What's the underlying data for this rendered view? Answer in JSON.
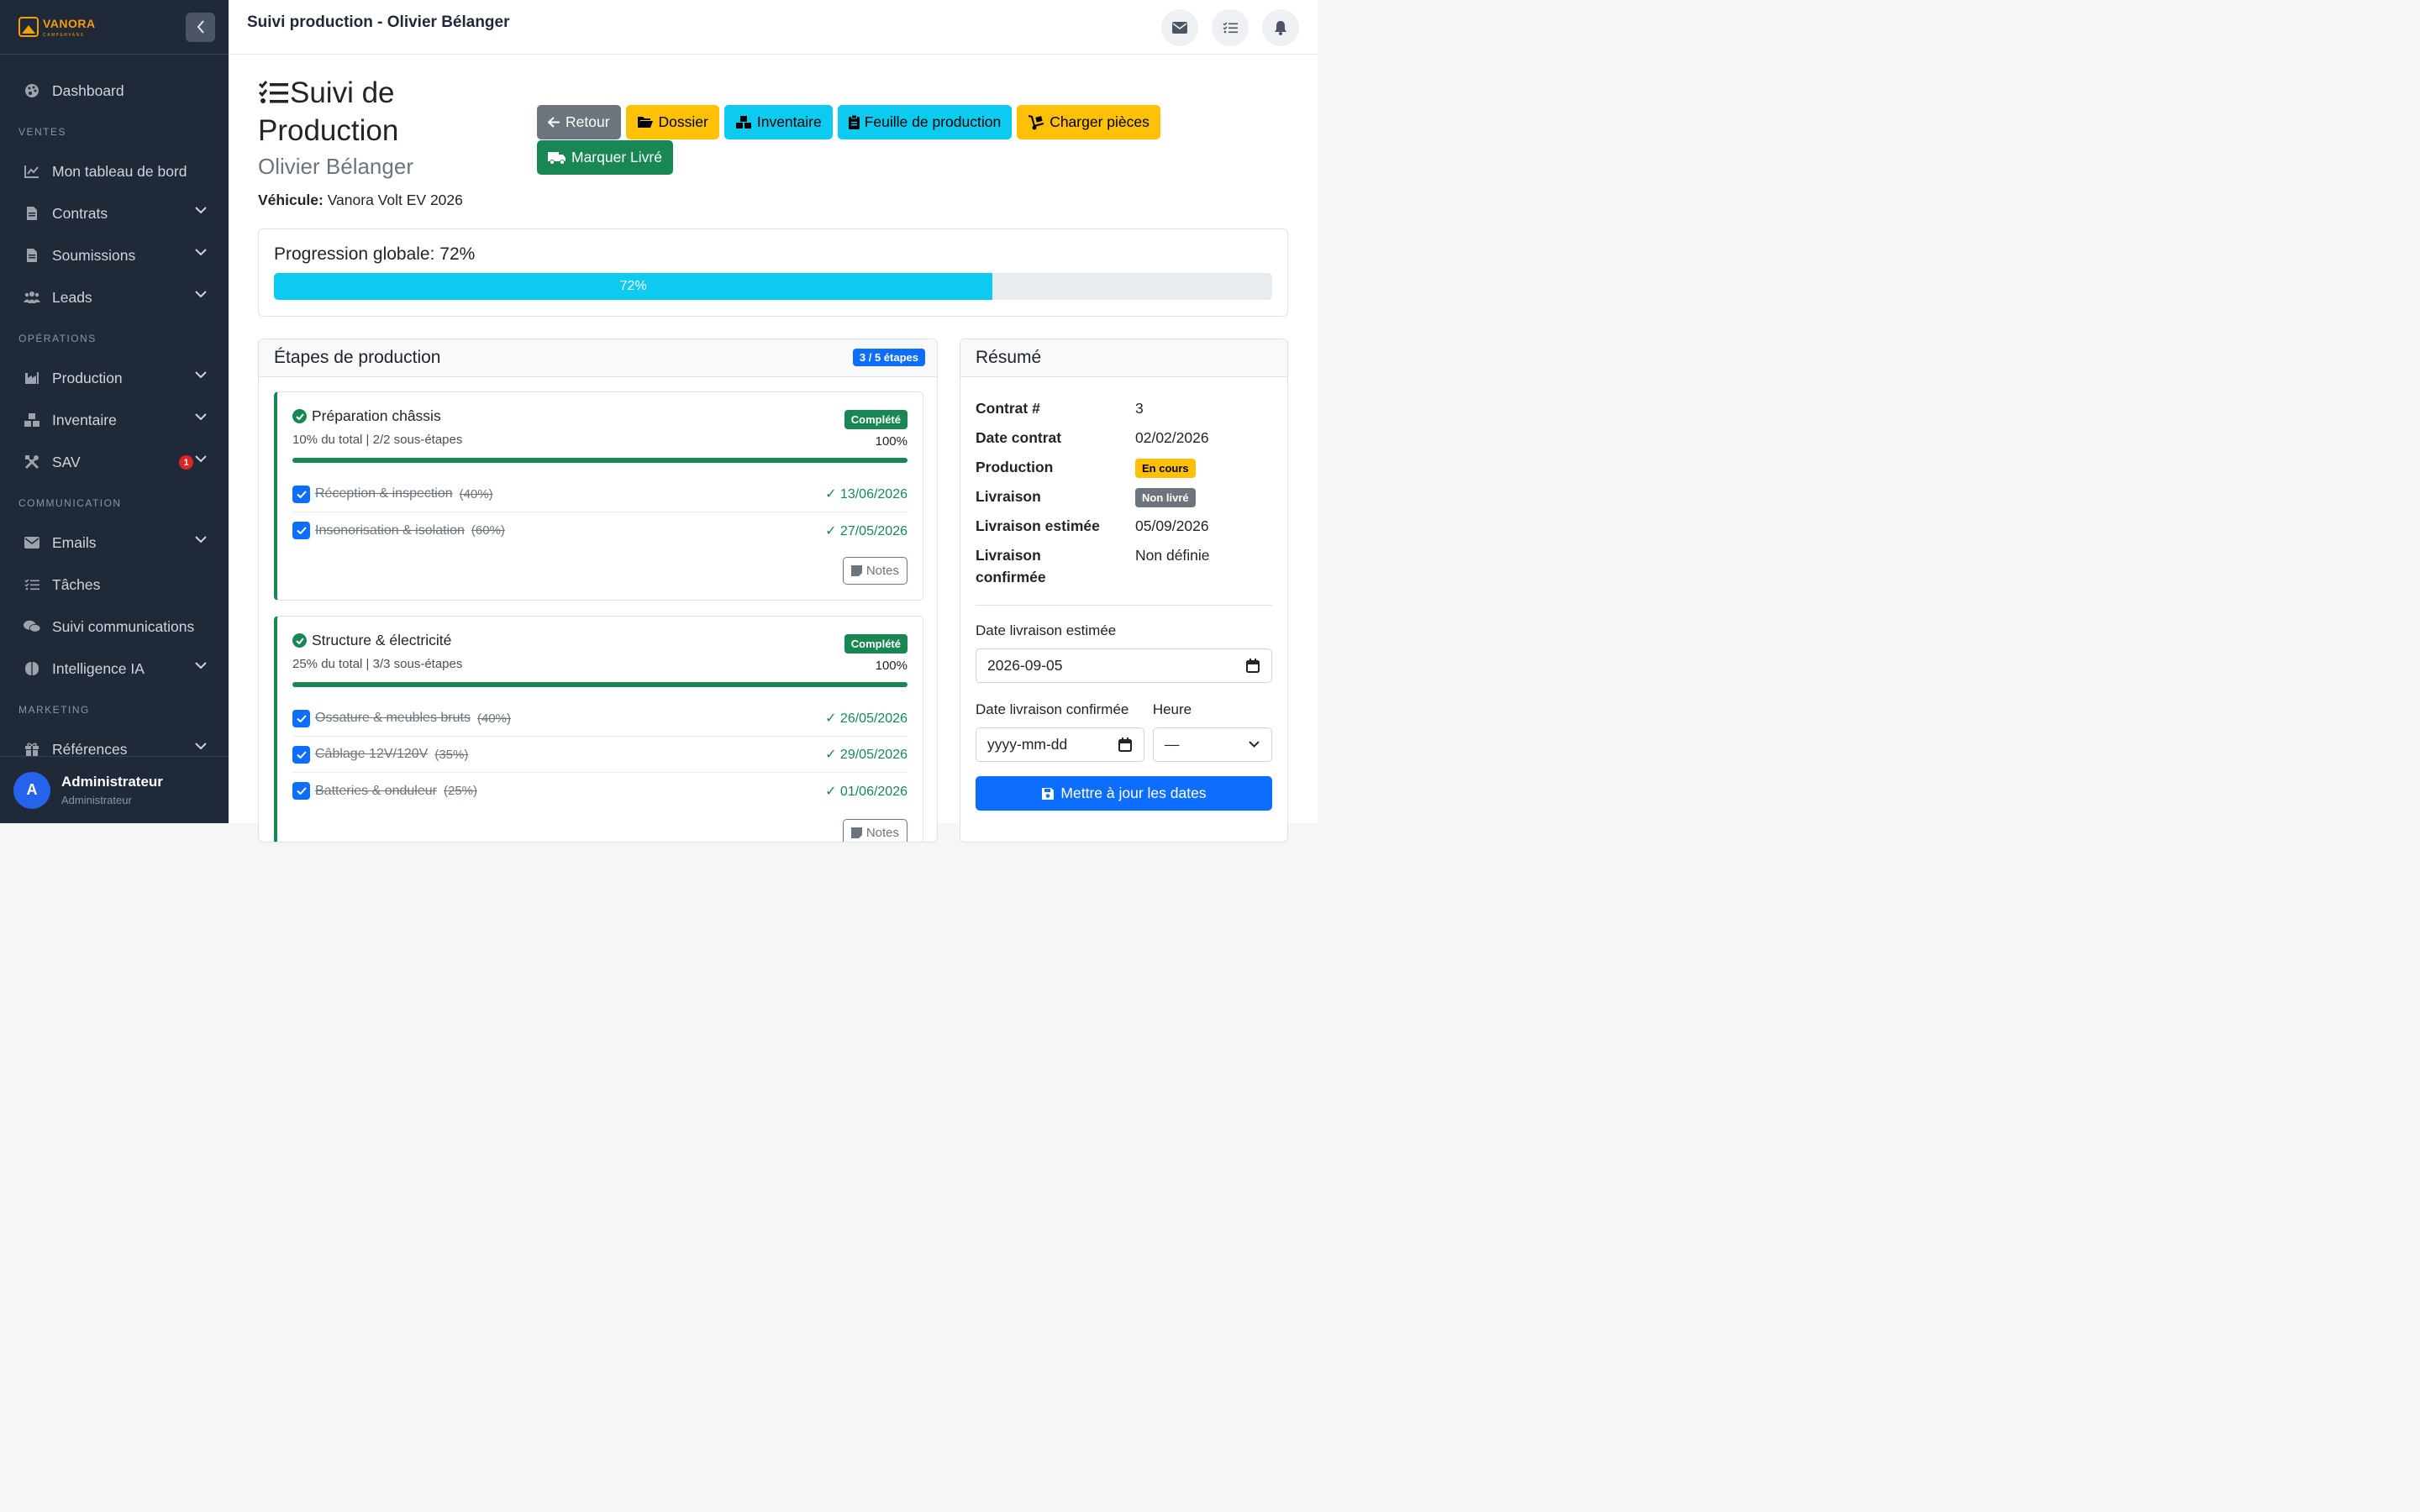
{
  "brand": {
    "name": "VANORA",
    "tagline": "CAMPERVANS"
  },
  "sidebar": {
    "items": [
      {
        "label": "Dashboard",
        "icon": "palette-icon"
      },
      {
        "section": "VENTES"
      },
      {
        "label": "Mon tableau de bord",
        "icon": "chart-line-icon"
      },
      {
        "label": "Contrats",
        "icon": "file-icon",
        "expandable": true
      },
      {
        "label": "Soumissions",
        "icon": "file-icon",
        "expandable": true
      },
      {
        "label": "Leads",
        "icon": "users-icon",
        "expandable": true
      },
      {
        "section": "OPÉRATIONS"
      },
      {
        "label": "Production",
        "icon": "industry-icon",
        "expandable": true
      },
      {
        "label": "Inventaire",
        "icon": "boxes-icon",
        "expandable": true
      },
      {
        "label": "SAV",
        "icon": "tools-icon",
        "expandable": true,
        "badge": "1"
      },
      {
        "section": "COMMUNICATION"
      },
      {
        "label": "Emails",
        "icon": "envelope-icon",
        "expandable": true
      },
      {
        "label": "Tâches",
        "icon": "tasks-icon"
      },
      {
        "label": "Suivi communications",
        "icon": "comments-icon"
      },
      {
        "label": "Intelligence IA",
        "icon": "brain-icon",
        "expandable": true
      },
      {
        "section": "MARKETING"
      },
      {
        "label": "Références",
        "icon": "gift-icon",
        "expandable": true
      }
    ],
    "user": {
      "initial": "A",
      "name": "Administrateur",
      "role": "Administrateur"
    }
  },
  "topbar": {
    "title": "Suivi production - Olivier Bélanger"
  },
  "page": {
    "title": "Suivi de Production",
    "client": "Olivier Bélanger",
    "vehicle_label": "Véhicule:",
    "vehicle_value": "Vanora Volt EV 2026"
  },
  "actions": {
    "back": "Retour",
    "folder": "Dossier",
    "inventory": "Inventaire",
    "sheet": "Feuille de production",
    "load_parts": "Charger pièces",
    "mark_delivered": "Marquer Livré"
  },
  "progress": {
    "label": "Progression globale: 72%",
    "value": 72,
    "bar_text": "72%"
  },
  "steps": {
    "header": "Étapes de production",
    "count": "3 / 5 étapes",
    "notes_label": "Notes",
    "items": [
      {
        "title": "Préparation châssis",
        "meta": "10% du total | 2/2 sous-étapes",
        "status": "Complété",
        "percent": "100%",
        "subs": [
          {
            "name": "Réception & inspection",
            "weight": "(40%)",
            "date": "13/06/2026"
          },
          {
            "name": "Insonorisation & isolation",
            "weight": "(60%)",
            "date": "27/05/2026"
          }
        ]
      },
      {
        "title": "Structure & électricité",
        "meta": "25% du total | 3/3 sous-étapes",
        "status": "Complété",
        "percent": "100%",
        "subs": [
          {
            "name": "Ossature & meubles bruts",
            "weight": "(40%)",
            "date": "26/05/2026"
          },
          {
            "name": "Câblage 12V/120V",
            "weight": "(35%)",
            "date": "29/05/2026"
          },
          {
            "name": "Batteries & onduleur",
            "weight": "(25%)",
            "date": "01/06/2026"
          }
        ]
      }
    ]
  },
  "summary": {
    "header": "Résumé",
    "rows": [
      {
        "k": "Contrat #",
        "v": "3"
      },
      {
        "k": "Date contrat",
        "v": "02/02/2026"
      },
      {
        "k": "Production",
        "pill": "En cours"
      },
      {
        "k": "Livraison",
        "pill": "Non livré"
      },
      {
        "k": "Livraison estimée",
        "v": "05/09/2026"
      },
      {
        "k": "Livraison confirmée",
        "v": "Non définie"
      }
    ],
    "est_label": "Date livraison estimée",
    "est_value": "2026-09-05",
    "conf_label": "Date livraison confirmée",
    "conf_placeholder": "yyyy-mm-dd",
    "time_label": "Heure",
    "time_value": "—",
    "update_btn": "Mettre à jour les dates"
  },
  "colors": {
    "sidebar_bg": "#1f2937",
    "accent": "#f59e0b",
    "info": "#0dcaf0",
    "success": "#198754",
    "primary": "#0d6efd"
  }
}
